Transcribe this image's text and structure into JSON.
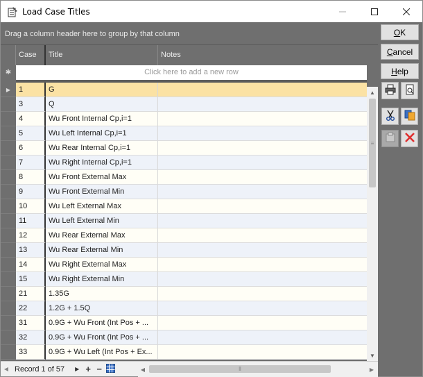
{
  "window": {
    "title": "Load Case Titles",
    "icon": "notebook-icon",
    "controls": [
      "minimize",
      "maximize",
      "close"
    ]
  },
  "grid": {
    "group_panel_text": "Drag a column header here to group by that column",
    "columns": [
      "Case",
      "Title",
      "Notes"
    ],
    "new_row_text": "Click here to add a new row",
    "rows": [
      {
        "case": "1",
        "title": "G",
        "notes": "",
        "selected": true
      },
      {
        "case": "3",
        "title": "Q",
        "notes": ""
      },
      {
        "case": "4",
        "title": "Wu Front Internal Cp,i=1",
        "notes": ""
      },
      {
        "case": "5",
        "title": "Wu Left Internal Cp,i=1",
        "notes": ""
      },
      {
        "case": "6",
        "title": "Wu Rear Internal Cp,i=1",
        "notes": ""
      },
      {
        "case": "7",
        "title": "Wu Right Internal Cp,i=1",
        "notes": ""
      },
      {
        "case": "8",
        "title": "Wu Front External Max",
        "notes": ""
      },
      {
        "case": "9",
        "title": "Wu Front External Min",
        "notes": ""
      },
      {
        "case": "10",
        "title": "Wu Left External Max",
        "notes": ""
      },
      {
        "case": "11",
        "title": "Wu Left External Min",
        "notes": ""
      },
      {
        "case": "12",
        "title": "Wu Rear External Max",
        "notes": ""
      },
      {
        "case": "13",
        "title": "Wu Rear External Min",
        "notes": ""
      },
      {
        "case": "14",
        "title": "Wu Right External Max",
        "notes": ""
      },
      {
        "case": "15",
        "title": "Wu Right External Min",
        "notes": ""
      },
      {
        "case": "21",
        "title": "1.35G",
        "notes": ""
      },
      {
        "case": "22",
        "title": "1.2G + 1.5Q",
        "notes": ""
      },
      {
        "case": "31",
        "title": "0.9G + Wu Front (Int Pos + ...",
        "notes": ""
      },
      {
        "case": "32",
        "title": "0.9G + Wu Front (Int Pos + ...",
        "notes": ""
      },
      {
        "case": "33",
        "title": "0.9G + Wu Left (Int Pos + Ex...",
        "notes": ""
      }
    ],
    "navigator": {
      "record_text": "Record 1 of 57"
    }
  },
  "side_buttons": {
    "ok": {
      "label": "OK",
      "underline": "O",
      "rest": "K"
    },
    "cancel": {
      "label": "Cancel",
      "underline": "C",
      "rest": "ancel"
    },
    "help": {
      "label": "Help",
      "underline": "H",
      "rest": "elp"
    }
  },
  "colors": {
    "selected_row": "#fbe2a4",
    "frame_gray": "#6f6f6f",
    "delete_red": "#e03030"
  }
}
